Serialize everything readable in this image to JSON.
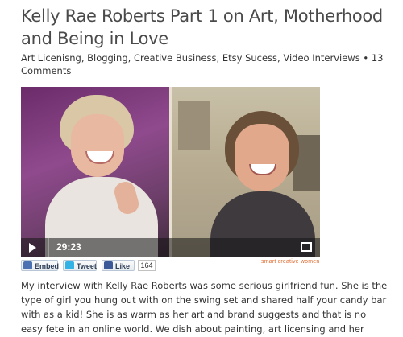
{
  "post": {
    "title": "Kelly Rae Roberts Part 1 on Art, Motherhood and Being in Love",
    "categories": "Art Licenisng, Blogging, Creative Business, Etsy Sucess, Video Interviews",
    "separator": "•",
    "comments": "13 Comments"
  },
  "video": {
    "time": "29:23"
  },
  "share": {
    "embed_label": "Embed",
    "tweet_label": "Tweet",
    "like_label": "Like",
    "like_count": "164"
  },
  "brand": {
    "text": "smart creative women"
  },
  "body": {
    "intro": "My interview with ",
    "link": "Kelly Rae Roberts",
    "rest": " was some serious girlfriend fun. She is the type of girl you hung out with on the swing set and shared half your candy bar with as a kid! She is as warm as her art and brand suggests and that is no easy fete in an online world. We dish about painting, art licensing and her business. We don't only talk"
  },
  "colors": {
    "brand_accent": "#e06a2e",
    "video_left_bg": "#7a3a78",
    "facebook": "#3b5998",
    "twitter": "#33b3e5"
  }
}
